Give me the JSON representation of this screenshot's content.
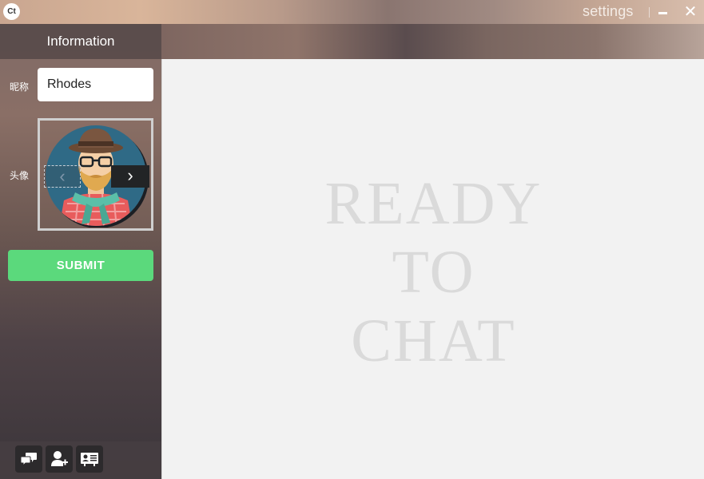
{
  "window": {
    "logo_text": "Ct",
    "title": "settings",
    "minimize_icon": "minimize-icon",
    "close_icon": "close-icon",
    "close_glyph": "✕"
  },
  "sidebar": {
    "header": "Information",
    "nickname_label": "昵称",
    "nickname_value": "Rhodes",
    "avatar_label": "头像",
    "avatar_icon": "avatar-hipster-icon",
    "prev_glyph": "‹",
    "next_glyph": "›",
    "submit_label": "SUBMIT"
  },
  "bottom_nav": [
    {
      "icon": "chat-bubbles-icon"
    },
    {
      "icon": "add-user-icon"
    },
    {
      "icon": "contact-card-icon"
    }
  ],
  "content": {
    "lines": [
      "READY",
      "TO",
      "CHAT"
    ]
  },
  "colors": {
    "submit": "#5bd97c",
    "content_bg": "#f2f2f2",
    "watermark": "#dadada"
  }
}
